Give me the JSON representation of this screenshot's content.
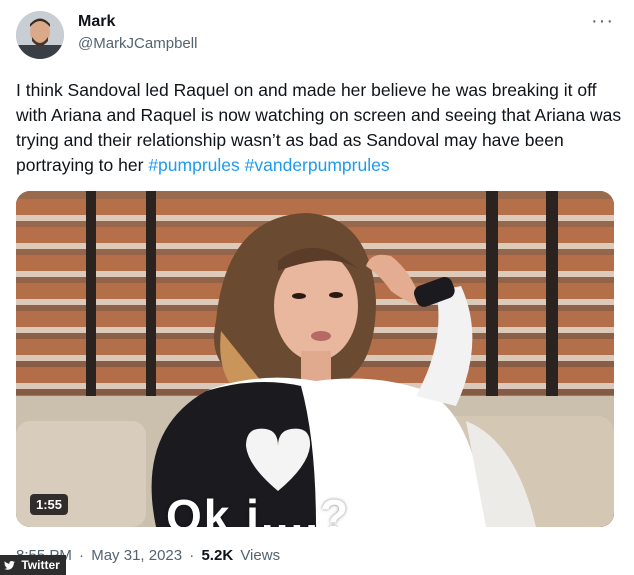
{
  "author": {
    "name": "Mark",
    "handle": "@MarkJCampbell"
  },
  "more_label": "···",
  "tweet": {
    "text": "I think Sandoval led Raquel on and made her believe he was breaking it off with Ariana and Raquel is now watching on screen and seeing that Ariana was trying and their relationship wasn’t as bad as Sandoval may have been portraying to her",
    "hashtags": [
      "#pumprules",
      "#vanderpumprules"
    ]
  },
  "video": {
    "duration": "1:55",
    "caption": "Ok i....?"
  },
  "meta": {
    "time": "8:55 PM",
    "separator": "·",
    "date": "May 31, 2023",
    "views_count": "5.2K",
    "views_label": "Views"
  },
  "watermark": {
    "label": "Twitter",
    "icon": "twitter-bird-icon"
  },
  "colors": {
    "hashtag": "#1d9bf0",
    "secondary_text": "#536471",
    "primary_text": "#0f1419"
  }
}
